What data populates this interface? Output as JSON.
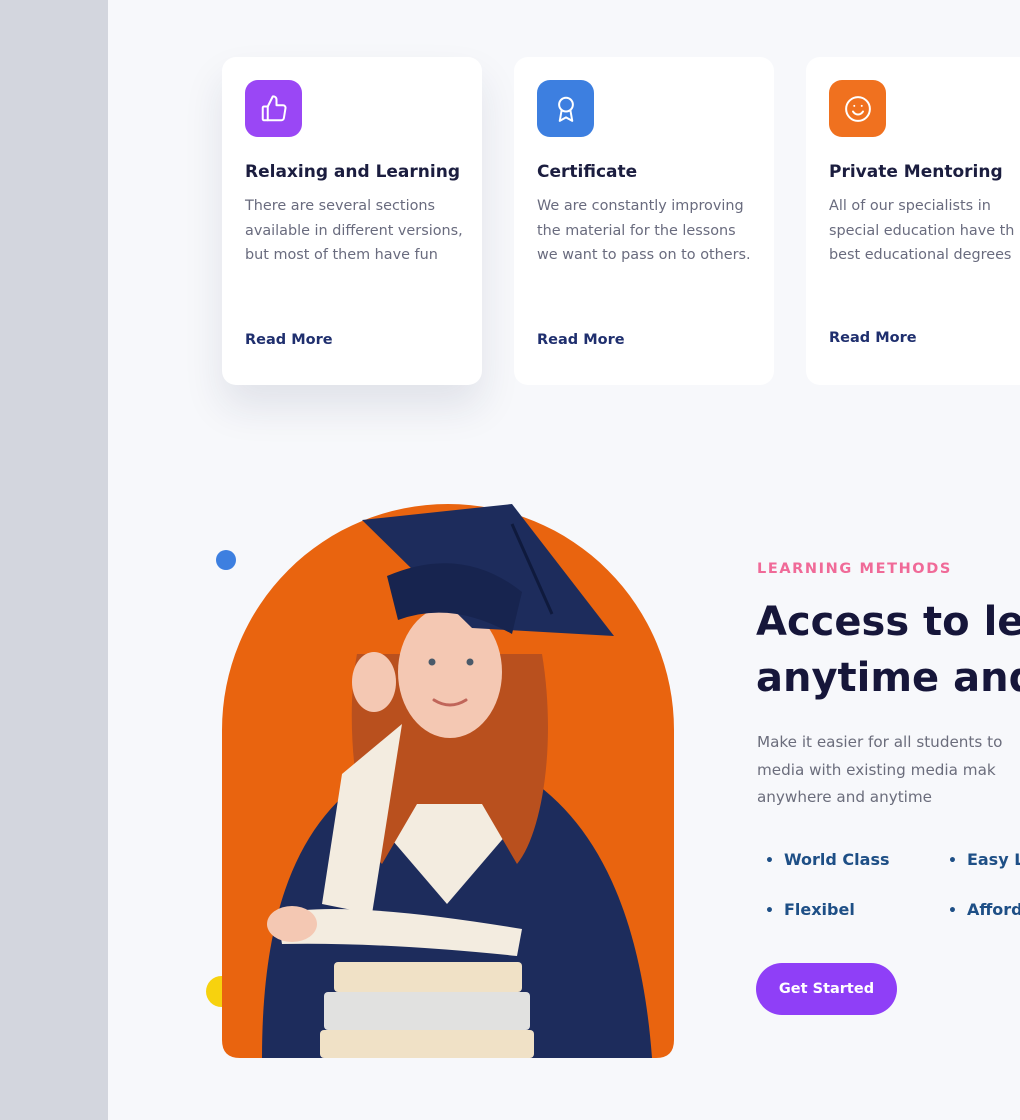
{
  "colors": {
    "page_bg": "#f7f8fb",
    "side_bg": "#d3d6de",
    "purple": "#9a47f5",
    "blue": "#3d7fe0",
    "orange": "#f0711f",
    "photo_orange": "#e9640f",
    "eyebrow_pink": "#f06a98",
    "cta_purple": "#8f3ff7",
    "dot_yellow": "#f7d20e"
  },
  "cards": [
    {
      "icon": "thumbs-up-icon",
      "icon_color": "#9a47f5",
      "title": "Relaxing and Learning",
      "text": "There are several sections available in different versions, but most of them have fun",
      "link": "Read More"
    },
    {
      "icon": "award-ribbon-icon",
      "icon_color": "#3d7fe0",
      "title": "Certificate",
      "text": "We are constantly improving the material for the lessons we want to pass on to others.",
      "link": "Read More"
    },
    {
      "icon": "smiley-face-icon",
      "icon_color": "#f0711f",
      "title": "Private Mentoring",
      "text": "All of our specialists in\nspecial education have th\nbest educational degrees",
      "link": "Read More"
    }
  ],
  "hero": {
    "image": "graduate-student-with-books-photo"
  },
  "learning": {
    "eyebrow": "LEARNING METHODS",
    "headline_line1": "Access to lea",
    "headline_line2": "anytime and",
    "desc_line1": "Make it easier for all students to",
    "desc_line2": "media with existing media mak",
    "desc_line3": "anywhere and anytime",
    "features": [
      "World Class",
      "Easy Le",
      "Flexibel",
      "Afforda"
    ],
    "cta": "Get Started"
  }
}
